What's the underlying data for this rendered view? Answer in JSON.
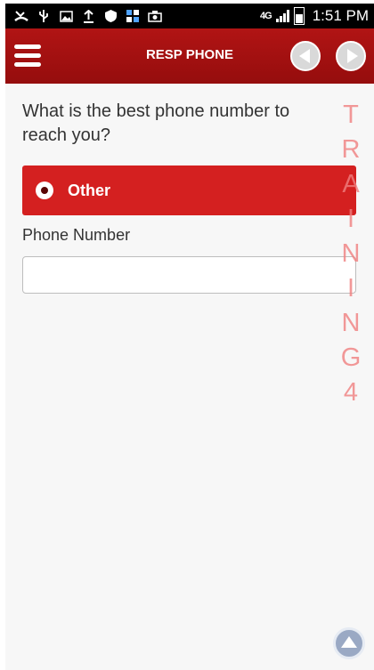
{
  "status_bar": {
    "icons": [
      "missed-call-icon",
      "usb-icon",
      "image-icon",
      "upload-icon",
      "shield-icon",
      "grid-app-icon",
      "camera-icon"
    ],
    "network": "4G",
    "time": "1:51 PM"
  },
  "app_bar": {
    "title": "RESP PHONE",
    "menu_icon": "hamburger-menu-icon",
    "prev_icon": "back-arrow-icon",
    "next_icon": "forward-arrow-icon"
  },
  "form": {
    "question": "What is the best phone number to reach you?",
    "option": {
      "label": "Other",
      "selected": true
    },
    "phone_label": "Phone Number",
    "phone_value": ""
  },
  "watermark": [
    "T",
    "R",
    "A",
    "I",
    "N",
    "I",
    "N",
    "G",
    "4"
  ],
  "colors": {
    "brand": "#a81010",
    "option": "#d42020",
    "watermark": "#f08080"
  }
}
